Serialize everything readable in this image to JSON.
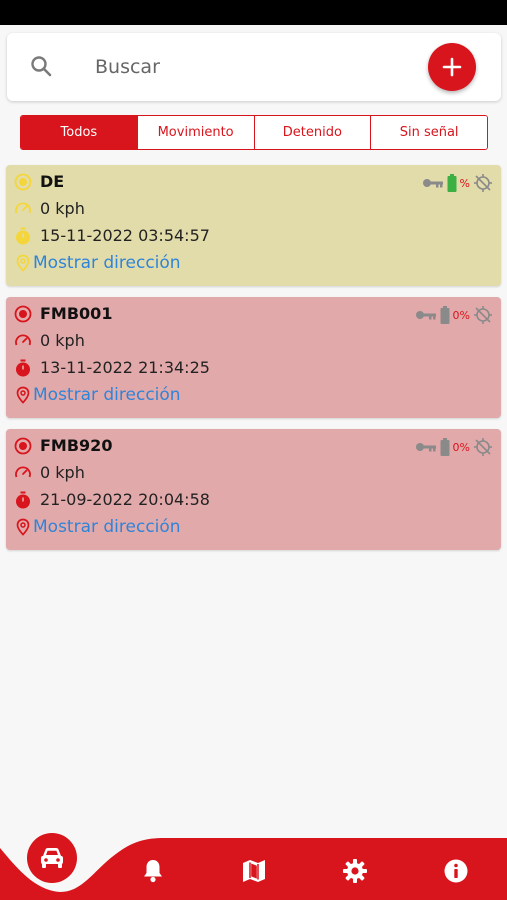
{
  "search": {
    "placeholder": "Buscar"
  },
  "filters": [
    {
      "label": "Todos",
      "active": true
    },
    {
      "label": "Movimiento",
      "active": false
    },
    {
      "label": "Detenido",
      "active": false
    },
    {
      "label": "Sin señal",
      "active": false
    }
  ],
  "vehicles": [
    {
      "name": "DE",
      "speed": "0 kph",
      "datetime": "15-11-2022 03:54:57",
      "address_link": "Mostrar dirección",
      "battery": "%",
      "status": "yellow"
    },
    {
      "name": "FMB001",
      "speed": "0 kph",
      "datetime": "13-11-2022 21:34:25",
      "address_link": "Mostrar dirección",
      "battery": "0%",
      "status": "red"
    },
    {
      "name": "FMB920",
      "speed": "0 kph",
      "datetime": "21-09-2022 20:04:58",
      "address_link": "Mostrar dirección",
      "battery": "0%",
      "status": "red"
    }
  ],
  "colors": {
    "accent": "#d8141c",
    "card_yellow": "#e2dcaa",
    "card_red": "#e2a9aa",
    "icon_yellow": "#f5d63a",
    "link": "#2f84d8",
    "battery_green": "#3cb043"
  },
  "nav": {
    "items": [
      "car-icon",
      "bell-icon",
      "map-icon",
      "gear-icon",
      "info-icon"
    ]
  }
}
